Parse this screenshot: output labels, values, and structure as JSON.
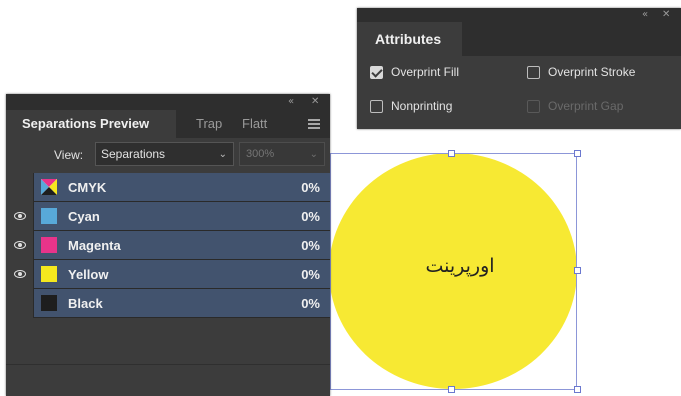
{
  "attributes_panel": {
    "collapse_icon": "«",
    "close_icon": "✕",
    "tab_title": "Attributes",
    "options": [
      {
        "label": "Overprint Fill",
        "checked": true,
        "disabled": false
      },
      {
        "label": "Overprint Stroke",
        "checked": false,
        "disabled": false
      },
      {
        "label": "Nonprinting",
        "checked": false,
        "disabled": false
      },
      {
        "label": "Overprint Gap",
        "checked": false,
        "disabled": true
      }
    ]
  },
  "separations_panel": {
    "collapse_icon": "«",
    "close_icon": "✕",
    "tabs": [
      "Separations Preview",
      "Trap",
      "Flatt"
    ],
    "view_label": "View:",
    "view_value": "Separations",
    "zoom_value": "300%",
    "rows": [
      {
        "name": "CMYK",
        "percent": "0%",
        "visible": false,
        "swatch": "cmyk"
      },
      {
        "name": "Cyan",
        "percent": "0%",
        "visible": true,
        "swatch": "#58a9d9"
      },
      {
        "name": "Magenta",
        "percent": "0%",
        "visible": true,
        "swatch": "#e8348a"
      },
      {
        "name": "Yellow",
        "percent": "0%",
        "visible": true,
        "swatch": "#f5e81e"
      },
      {
        "name": "Black",
        "percent": "0%",
        "visible": false,
        "swatch": "#1e1e1e"
      }
    ]
  },
  "artwork": {
    "label": "اورپرینت",
    "fill_color": "#f7e933"
  }
}
